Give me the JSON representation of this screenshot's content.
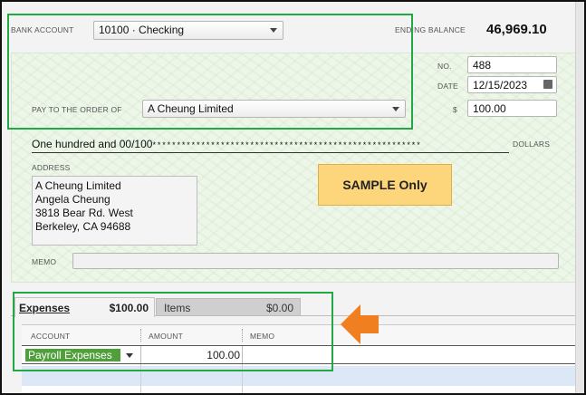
{
  "bank": {
    "label": "BANK ACCOUNT",
    "value": "10100 · Checking"
  },
  "ending_balance": {
    "label": "ENDING BALANCE",
    "value": "46,969.10"
  },
  "check": {
    "no_label": "NO.",
    "no_value": "488",
    "date_label": "DATE",
    "date_value": "12/15/2023",
    "amount_label": "$",
    "amount_value": "100.00",
    "payto_label": "PAY TO THE ORDER OF",
    "payto_value": "A Cheung Limited",
    "written_amount": "One hundred and 00/100",
    "stars": "* * * * * * * * * * * * * * * * * * * * * * * * * * * * * * * * * * * * * * * * * * * * * * * * * * * * * * *",
    "dollars_label": "DOLLARS",
    "address_label": "ADDRESS",
    "address_lines": [
      "A Cheung Limited",
      "Angela Cheung",
      "3818 Bear Rd. West",
      "Berkeley, CA 94688"
    ],
    "memo_label": "MEMO",
    "memo_value": ""
  },
  "sample_note": "SAMPLE Only",
  "tabs": {
    "expenses_label": "Expenses",
    "expenses_amount": "$100.00",
    "items_label": "Items",
    "items_amount": "$0.00"
  },
  "columns": {
    "account": "ACCOUNT",
    "amount": "AMOUNT",
    "memo": "MEMO"
  },
  "row": {
    "account": "Payroll Expenses",
    "amount": "100.00",
    "memo": ""
  },
  "colors": {
    "highlight_green": "#22a846",
    "arrow_orange": "#f07f1f",
    "sample_fill": "#fdd57a",
    "account_cell": "#4f9f3a"
  }
}
